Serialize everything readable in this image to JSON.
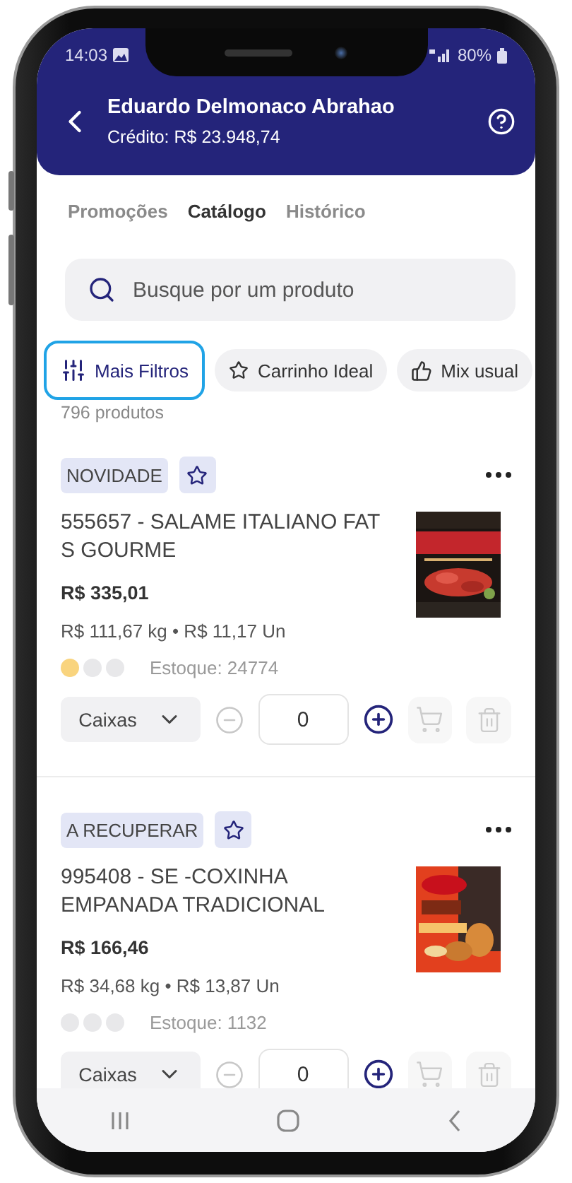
{
  "status_bar": {
    "time": "14:03",
    "battery": "80%"
  },
  "header": {
    "title": "Eduardo Delmonaco Abrahao",
    "subtitle": "Crédito: R$ 23.948,74"
  },
  "tabs": [
    {
      "label": "Promoções",
      "selected": false
    },
    {
      "label": "Catálogo",
      "selected": true
    },
    {
      "label": "Histórico",
      "selected": false
    }
  ],
  "search": {
    "placeholder": "Busque por um produto"
  },
  "filters": [
    {
      "label": "Mais Filtros",
      "kind": "filters",
      "selected": true
    },
    {
      "label": "Carrinho Ideal",
      "kind": "star",
      "selected": false
    },
    {
      "label": "Mix usual",
      "kind": "like",
      "selected": false
    }
  ],
  "result_count": "796 produtos",
  "products": [
    {
      "tag": "NOVIDADE",
      "name": "555657 - SALAME ITALIANO FAT S GOURME",
      "price": "R$ 335,01",
      "unit_prices": "R$ 111,67 kg • R$ 11,17 Un",
      "stock_dots": [
        {
          "color": "#f9d47e"
        },
        {
          "color": "#e8e8ea"
        },
        {
          "color": "#e8e8ea"
        }
      ],
      "stock": "Estoque: 24774",
      "unit": "Caixas",
      "quantity": "0"
    },
    {
      "tag": "A RECUPERAR",
      "name": "995408 - SE -COXINHA EMPANADA TRADICIONAL",
      "price": "R$ 166,46",
      "unit_prices": "R$ 34,68 kg • R$ 13,87 Un",
      "stock_dots": [
        {
          "color": "#e8e8ea"
        },
        {
          "color": "#e8e8ea"
        },
        {
          "color": "#e8e8ea"
        }
      ],
      "stock": "Estoque: 1132",
      "unit": "Caixas",
      "quantity": "0"
    }
  ]
}
